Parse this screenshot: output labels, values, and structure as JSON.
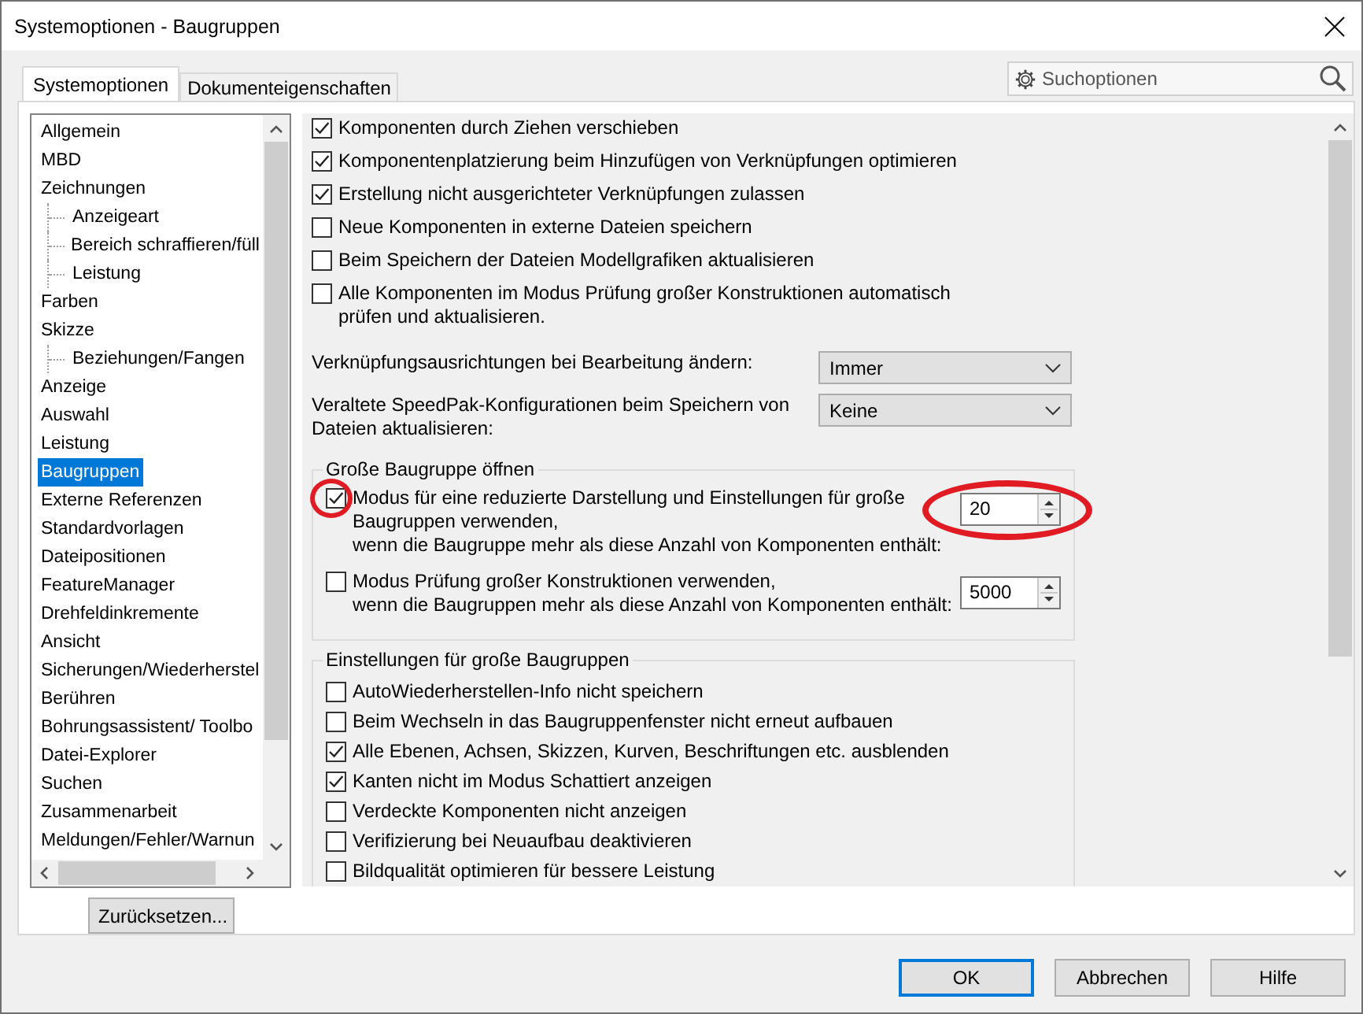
{
  "window": {
    "title": "Systemoptionen - Baugruppen"
  },
  "tabs": [
    {
      "label": "Systemoptionen",
      "selected": true
    },
    {
      "label": "Dokumenteigenschaften",
      "selected": false
    }
  ],
  "search": {
    "placeholder": "Suchoptionen"
  },
  "tree": [
    {
      "label": "Allgemein",
      "selected": false
    },
    {
      "label": "MBD",
      "selected": false
    },
    {
      "label": "Zeichnungen",
      "selected": false,
      "children": [
        {
          "label": "Anzeigeart",
          "selected": false
        },
        {
          "label": "Bereich schraffieren/füll",
          "selected": false
        },
        {
          "label": "Leistung",
          "selected": false
        }
      ]
    },
    {
      "label": "Farben",
      "selected": false
    },
    {
      "label": "Skizze",
      "selected": false,
      "children": [
        {
          "label": "Beziehungen/Fangen",
          "selected": false
        }
      ]
    },
    {
      "label": "Anzeige",
      "selected": false
    },
    {
      "label": "Auswahl",
      "selected": false
    },
    {
      "label": "Leistung",
      "selected": false
    },
    {
      "label": "Baugruppen",
      "selected": true
    },
    {
      "label": "Externe Referenzen",
      "selected": false
    },
    {
      "label": "Standardvorlagen",
      "selected": false
    },
    {
      "label": "Dateipositionen",
      "selected": false
    },
    {
      "label": "FeatureManager",
      "selected": false
    },
    {
      "label": "Drehfeldinkremente",
      "selected": false
    },
    {
      "label": "Ansicht",
      "selected": false
    },
    {
      "label": "Sicherungen/Wiederherstel",
      "selected": false
    },
    {
      "label": "Berühren",
      "selected": false
    },
    {
      "label": "Bohrungsassistent/ Toolbo",
      "selected": false
    },
    {
      "label": "Datei-Explorer",
      "selected": false
    },
    {
      "label": "Suchen",
      "selected": false
    },
    {
      "label": "Zusammenarbeit",
      "selected": false
    },
    {
      "label": "Meldungen/Fehler/Warnun",
      "selected": false
    }
  ],
  "reset_button": "Zurücksetzen...",
  "options": [
    {
      "label": "Komponenten durch Ziehen verschieben",
      "checked": true
    },
    {
      "label": "Komponentenplatzierung beim Hinzufügen von Verknüpfungen optimieren",
      "checked": true
    },
    {
      "label": "Erstellung nicht ausgerichteter Verknüpfungen zulassen",
      "checked": true
    },
    {
      "label": "Neue Komponenten in externe Dateien speichern",
      "checked": false
    },
    {
      "label": "Beim Speichern der Dateien Modellgrafiken aktualisieren",
      "checked": false
    },
    {
      "label": "Alle Komponenten im Modus Prüfung großer Konstruktionen automatisch\nprüfen und aktualisieren.",
      "checked": false
    }
  ],
  "dropdowns": [
    {
      "label": "Verknüpfungsausrichtungen bei Bearbeitung ändern:",
      "value": "Immer"
    },
    {
      "label": "Veraltete SpeedPak-Konfigurationen beim Speichern von\nDateien aktualisieren:",
      "value": "Keine"
    }
  ],
  "large_assembly_open": {
    "title": "Große Baugruppe öffnen",
    "items": [
      {
        "label": "Modus für eine reduzierte Darstellung und Einstellungen für große\nBaugruppen verwenden,\nwenn die Baugruppe mehr als diese Anzahl von Komponenten enthält:",
        "checked": true,
        "value": "20"
      },
      {
        "label": "Modus Prüfung großer Konstruktionen verwenden,\nwenn die Baugruppen mehr als diese Anzahl von Komponenten enthält:",
        "checked": false,
        "value": "5000"
      }
    ]
  },
  "large_assembly_settings": {
    "title": "Einstellungen für große Baugruppen",
    "items": [
      {
        "label": "AutoWiederherstellen-Info nicht speichern",
        "checked": false
      },
      {
        "label": "Beim Wechseln in das Baugruppenfenster nicht erneut aufbauen",
        "checked": false
      },
      {
        "label": "Alle Ebenen, Achsen, Skizzen, Kurven, Beschriftungen etc. ausblenden",
        "checked": true
      },
      {
        "label": "Kanten nicht im Modus Schattiert anzeigen",
        "checked": true
      },
      {
        "label": "Verdeckte Komponenten nicht anzeigen",
        "checked": false
      },
      {
        "label": "Verifizierung bei Neuaufbau deaktivieren",
        "checked": false
      },
      {
        "label": "Bildqualität optimieren für bessere Leistung",
        "checked": false
      }
    ]
  },
  "buttons": [
    {
      "label": "OK",
      "default": true
    },
    {
      "label": "Abbrechen",
      "default": false
    },
    {
      "label": "Hilfe",
      "default": false
    }
  ]
}
